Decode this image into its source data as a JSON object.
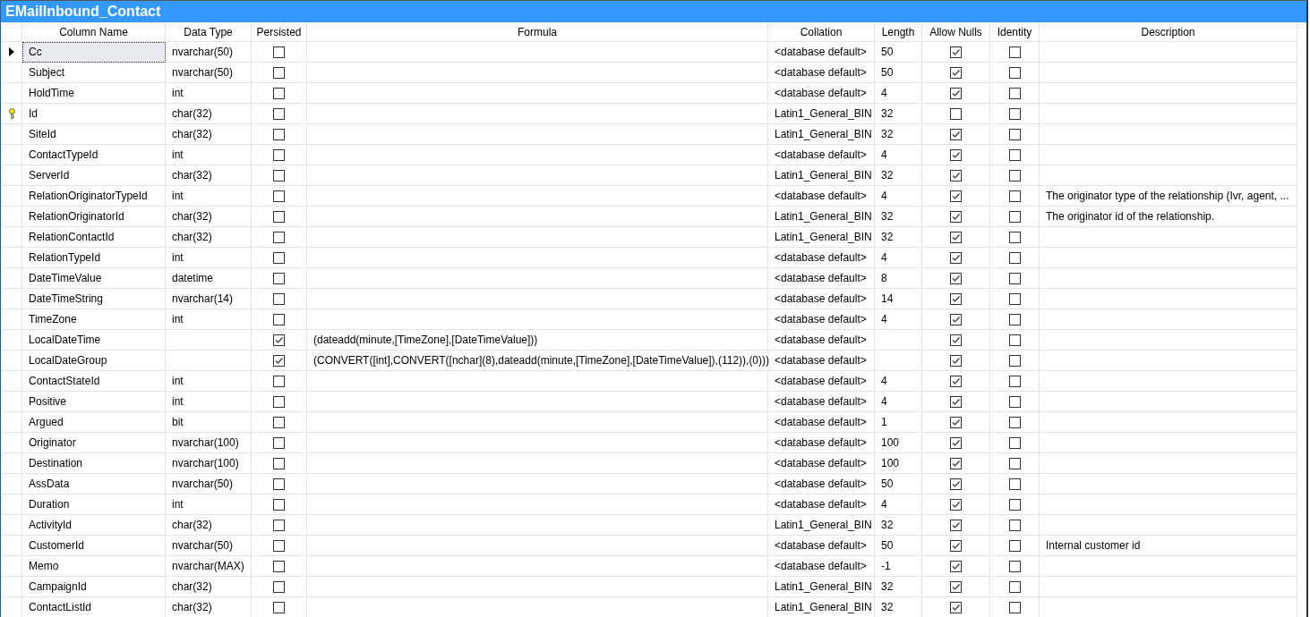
{
  "window": {
    "title": "EMailInbound_Contact"
  },
  "table": {
    "columns": [
      "Column Name",
      "Data Type",
      "Persisted",
      "Formula",
      "Collation",
      "Length",
      "Allow Nulls",
      "Identity",
      "Description"
    ],
    "rows": [
      {
        "name": "Cc",
        "data_type": "nvarchar(50)",
        "persisted": false,
        "collation": "<database default>",
        "length": "50",
        "allow_nulls": true,
        "identity": false,
        "primary_key": false,
        "selected": true
      },
      {
        "name": "Subject",
        "data_type": "nvarchar(50)",
        "persisted": false,
        "collation": "<database default>",
        "length": "50",
        "allow_nulls": true,
        "identity": false,
        "primary_key": false,
        "selected": false
      },
      {
        "name": "HoldTime",
        "data_type": "int",
        "persisted": false,
        "collation": "<database default>",
        "length": "4",
        "allow_nulls": true,
        "identity": false,
        "primary_key": false,
        "selected": false
      },
      {
        "name": "Id",
        "data_type": "char(32)",
        "persisted": false,
        "collation": "Latin1_General_BIN",
        "length": "32",
        "allow_nulls": false,
        "identity": false,
        "primary_key": true,
        "selected": false
      },
      {
        "name": "SiteId",
        "data_type": "char(32)",
        "persisted": false,
        "collation": "Latin1_General_BIN",
        "length": "32",
        "allow_nulls": true,
        "identity": false,
        "primary_key": false,
        "selected": false
      },
      {
        "name": "ContactTypeId",
        "data_type": "int",
        "persisted": false,
        "collation": "<database default>",
        "length": "4",
        "allow_nulls": true,
        "identity": false,
        "primary_key": false,
        "selected": false
      },
      {
        "name": "ServerId",
        "data_type": "char(32)",
        "persisted": false,
        "collation": "Latin1_General_BIN",
        "length": "32",
        "allow_nulls": true,
        "identity": false,
        "primary_key": false,
        "selected": false
      },
      {
        "name": "RelationOriginatorTypeId",
        "data_type": "int",
        "persisted": false,
        "collation": "<database default>",
        "length": "4",
        "allow_nulls": true,
        "identity": false,
        "description": "The originator type of the relationship (Ivr, agent, ...",
        "primary_key": false,
        "selected": false
      },
      {
        "name": "RelationOriginatorId",
        "data_type": "char(32)",
        "persisted": false,
        "collation": "Latin1_General_BIN",
        "length": "32",
        "allow_nulls": true,
        "identity": false,
        "description": "The originator id of the relationship.",
        "primary_key": false,
        "selected": false
      },
      {
        "name": "RelationContactId",
        "data_type": "char(32)",
        "persisted": false,
        "collation": "Latin1_General_BIN",
        "length": "32",
        "allow_nulls": true,
        "identity": false,
        "primary_key": false,
        "selected": false
      },
      {
        "name": "RelationTypeId",
        "data_type": "int",
        "persisted": false,
        "collation": "<database default>",
        "length": "4",
        "allow_nulls": true,
        "identity": false,
        "primary_key": false,
        "selected": false
      },
      {
        "name": "DateTimeValue",
        "data_type": "datetime",
        "persisted": false,
        "collation": "<database default>",
        "length": "8",
        "allow_nulls": true,
        "identity": false,
        "primary_key": false,
        "selected": false
      },
      {
        "name": "DateTimeString",
        "data_type": "nvarchar(14)",
        "persisted": false,
        "collation": "<database default>",
        "length": "14",
        "allow_nulls": true,
        "identity": false,
        "primary_key": false,
        "selected": false
      },
      {
        "name": "TimeZone",
        "data_type": "int",
        "persisted": false,
        "collation": "<database default>",
        "length": "4",
        "allow_nulls": true,
        "identity": false,
        "primary_key": false,
        "selected": false
      },
      {
        "name": "LocalDateTime",
        "persisted": true,
        "formula": "(dateadd(minute,[TimeZone],[DateTimeValue]))",
        "collation": "<database default>",
        "allow_nulls": true,
        "identity": false,
        "primary_key": false,
        "selected": false
      },
      {
        "name": "LocalDateGroup",
        "persisted": true,
        "formula": "(CONVERT([int],CONVERT([nchar](8),dateadd(minute,[TimeZone],[DateTimeValue]),(112)),(0)))",
        "collation": "<database default>",
        "allow_nulls": true,
        "identity": false,
        "primary_key": false,
        "selected": false
      },
      {
        "name": "ContactStateId",
        "data_type": "int",
        "persisted": false,
        "collation": "<database default>",
        "length": "4",
        "allow_nulls": true,
        "identity": false,
        "primary_key": false,
        "selected": false
      },
      {
        "name": "Positive",
        "data_type": "int",
        "persisted": false,
        "collation": "<database default>",
        "length": "4",
        "allow_nulls": true,
        "identity": false,
        "primary_key": false,
        "selected": false
      },
      {
        "name": "Argued",
        "data_type": "bit",
        "persisted": false,
        "collation": "<database default>",
        "length": "1",
        "allow_nulls": true,
        "identity": false,
        "primary_key": false,
        "selected": false
      },
      {
        "name": "Originator",
        "data_type": "nvarchar(100)",
        "persisted": false,
        "collation": "<database default>",
        "length": "100",
        "allow_nulls": true,
        "identity": false,
        "primary_key": false,
        "selected": false
      },
      {
        "name": "Destination",
        "data_type": "nvarchar(100)",
        "persisted": false,
        "collation": "<database default>",
        "length": "100",
        "allow_nulls": true,
        "identity": false,
        "primary_key": false,
        "selected": false
      },
      {
        "name": "AssData",
        "data_type": "nvarchar(50)",
        "persisted": false,
        "collation": "<database default>",
        "length": "50",
        "allow_nulls": true,
        "identity": false,
        "primary_key": false,
        "selected": false
      },
      {
        "name": "Duration",
        "data_type": "int",
        "persisted": false,
        "collation": "<database default>",
        "length": "4",
        "allow_nulls": true,
        "identity": false,
        "primary_key": false,
        "selected": false
      },
      {
        "name": "ActivityId",
        "data_type": "char(32)",
        "persisted": false,
        "collation": "Latin1_General_BIN",
        "length": "32",
        "allow_nulls": true,
        "identity": false,
        "primary_key": false,
        "selected": false
      },
      {
        "name": "CustomerId",
        "data_type": "nvarchar(50)",
        "persisted": false,
        "collation": "<database default>",
        "length": "50",
        "allow_nulls": true,
        "identity": false,
        "description": "Internal customer id",
        "primary_key": false,
        "selected": false
      },
      {
        "name": "Memo",
        "data_type": "nvarchar(MAX)",
        "persisted": false,
        "collation": "<database default>",
        "length": "-1",
        "allow_nulls": true,
        "identity": false,
        "primary_key": false,
        "selected": false
      },
      {
        "name": "CampaignId",
        "data_type": "char(32)",
        "persisted": false,
        "collation": "Latin1_General_BIN",
        "length": "32",
        "allow_nulls": true,
        "identity": false,
        "primary_key": false,
        "selected": false
      },
      {
        "name": "ContactListId",
        "data_type": "char(32)",
        "persisted": false,
        "collation": "Latin1_General_BIN",
        "length": "32",
        "allow_nulls": true,
        "identity": false,
        "primary_key": false,
        "selected": false
      }
    ]
  }
}
